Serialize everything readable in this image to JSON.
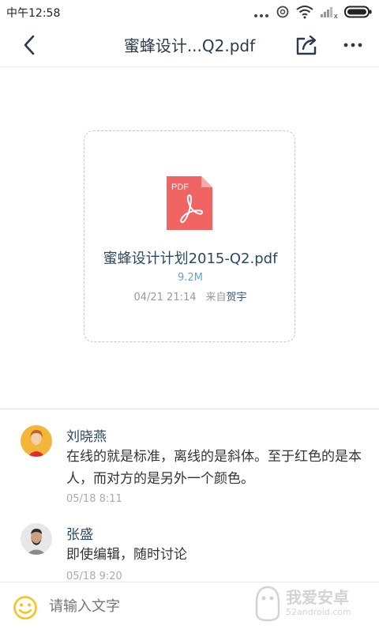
{
  "status_bar": {
    "time": "中午12:58",
    "signal_suffix": "x"
  },
  "nav": {
    "title": "蜜蜂设计...Q2.pdf"
  },
  "file": {
    "icon_label": "PDF",
    "name": "蜜蜂设计计划2015-Q2.pdf",
    "size": "9.2M",
    "date": "04/21  21:14",
    "from_label": "来自",
    "sender": "贺宇"
  },
  "comments": [
    {
      "name": "刘晓燕",
      "text": "在线的就是标准，离线的是斜体。至于红色的是本人，而对方的是另外一个颜色。",
      "time": "05/18 8:11"
    },
    {
      "name": "张盛",
      "text": "即使编辑，随时讨论",
      "time": "05/18 9:20"
    }
  ],
  "input": {
    "placeholder": "请输入文字"
  },
  "watermark": {
    "text": "我爱安卓",
    "sub": "52android.com"
  },
  "colors": {
    "pdf_red": "#f06464",
    "accent_blue": "#6aa0d0",
    "name_blue": "#2b4860",
    "emoji_yellow": "#f5c518"
  }
}
